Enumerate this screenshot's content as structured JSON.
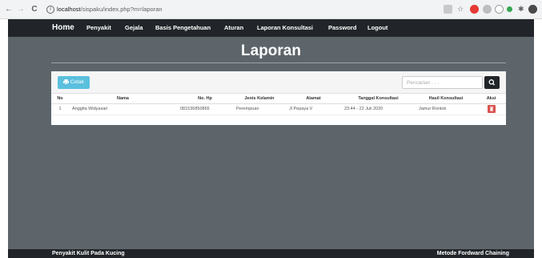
{
  "browser": {
    "url_host": "localhost",
    "url_path": "/sispaku/index.php?m=laporan",
    "back_glyph": "←",
    "forward_glyph": "→",
    "reload_glyph": "C",
    "info_glyph": "i",
    "star_glyph": "☆",
    "menu_glyph": "⋮"
  },
  "nav": {
    "items": [
      "Home",
      "Penyakit",
      "Gejala",
      "Basis Pengetahuan",
      "Aturan",
      "Laporan Konsultasi",
      "Password",
      "Logout"
    ]
  },
  "page": {
    "title": "Laporan"
  },
  "toolbar": {
    "print_label": "Cetak",
    "search_placeholder": "Pencarian . . ."
  },
  "table": {
    "headers": [
      "No",
      "Nama",
      "No. Hp",
      "Jenis Kelamin",
      "Alamat",
      "Tanggal Konsultasi",
      "Hasil Konsultasi",
      "Aksi"
    ],
    "rows": [
      {
        "no": "1",
        "nama": "Anggita Widyasari",
        "hp": "081536850865",
        "jk": "Perempuan",
        "alamat": "Jl Pepaya V",
        "tanggal": "23:44 - 22 Juli 2020",
        "hasil": "Jamur Rontok"
      }
    ]
  },
  "footer": {
    "left": "Penyakit Kulit Pada Kucing",
    "right": "Metode Fordward Chaining"
  },
  "colors": {
    "navbar": "#212529",
    "background": "#5e656a",
    "print_button": "#5bc0de",
    "delete_button": "#d9534f"
  }
}
